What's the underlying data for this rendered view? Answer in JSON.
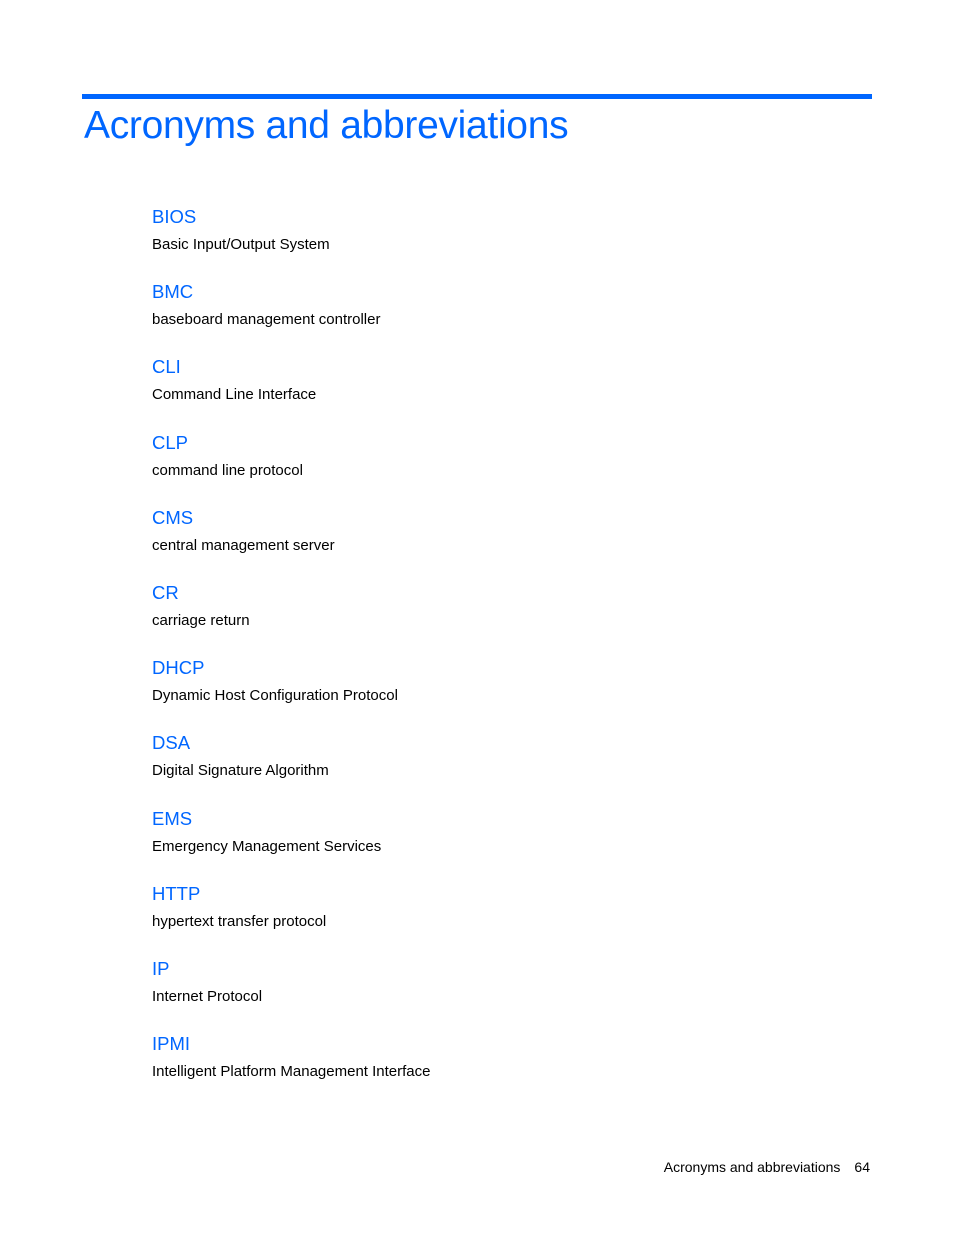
{
  "page": {
    "title": "Acronyms and abbreviations",
    "accent_color": "#0066ff"
  },
  "entries": [
    {
      "term": "BIOS",
      "definition": "Basic Input/Output System"
    },
    {
      "term": "BMC",
      "definition": "baseboard management controller"
    },
    {
      "term": "CLI",
      "definition": "Command Line Interface"
    },
    {
      "term": "CLP",
      "definition": "command line protocol"
    },
    {
      "term": "CMS",
      "definition": "central management server"
    },
    {
      "term": "CR",
      "definition": "carriage return"
    },
    {
      "term": "DHCP",
      "definition": "Dynamic Host Configuration Protocol"
    },
    {
      "term": "DSA",
      "definition": "Digital Signature Algorithm"
    },
    {
      "term": "EMS",
      "definition": "Emergency Management Services"
    },
    {
      "term": "HTTP",
      "definition": "hypertext transfer protocol"
    },
    {
      "term": "IP",
      "definition": "Internet Protocol"
    },
    {
      "term": "IPMI",
      "definition": "Intelligent Platform Management Interface"
    }
  ],
  "footer": {
    "section": "Acronyms and abbreviations",
    "page_number": "64"
  }
}
